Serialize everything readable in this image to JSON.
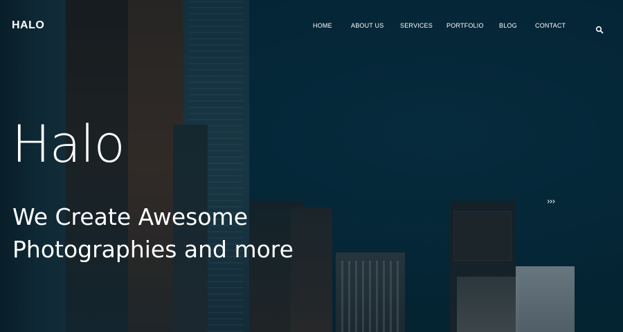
{
  "brand": {
    "logo_text": "HALO"
  },
  "nav": {
    "items": [
      {
        "label": "HOME"
      },
      {
        "label": "ABOUT US"
      },
      {
        "label": "SERVICES"
      },
      {
        "label": "PORTFOLIO"
      },
      {
        "label": "BLOG"
      },
      {
        "label": "CONTACT"
      }
    ],
    "search_icon": "search-icon"
  },
  "hero": {
    "title": "Halo",
    "subtitle_line1": "We Create Awesome",
    "subtitle_line2": "Photographies and more",
    "next_arrows": "›››"
  },
  "colors": {
    "background": "#06283a",
    "text": "#ffffff"
  }
}
